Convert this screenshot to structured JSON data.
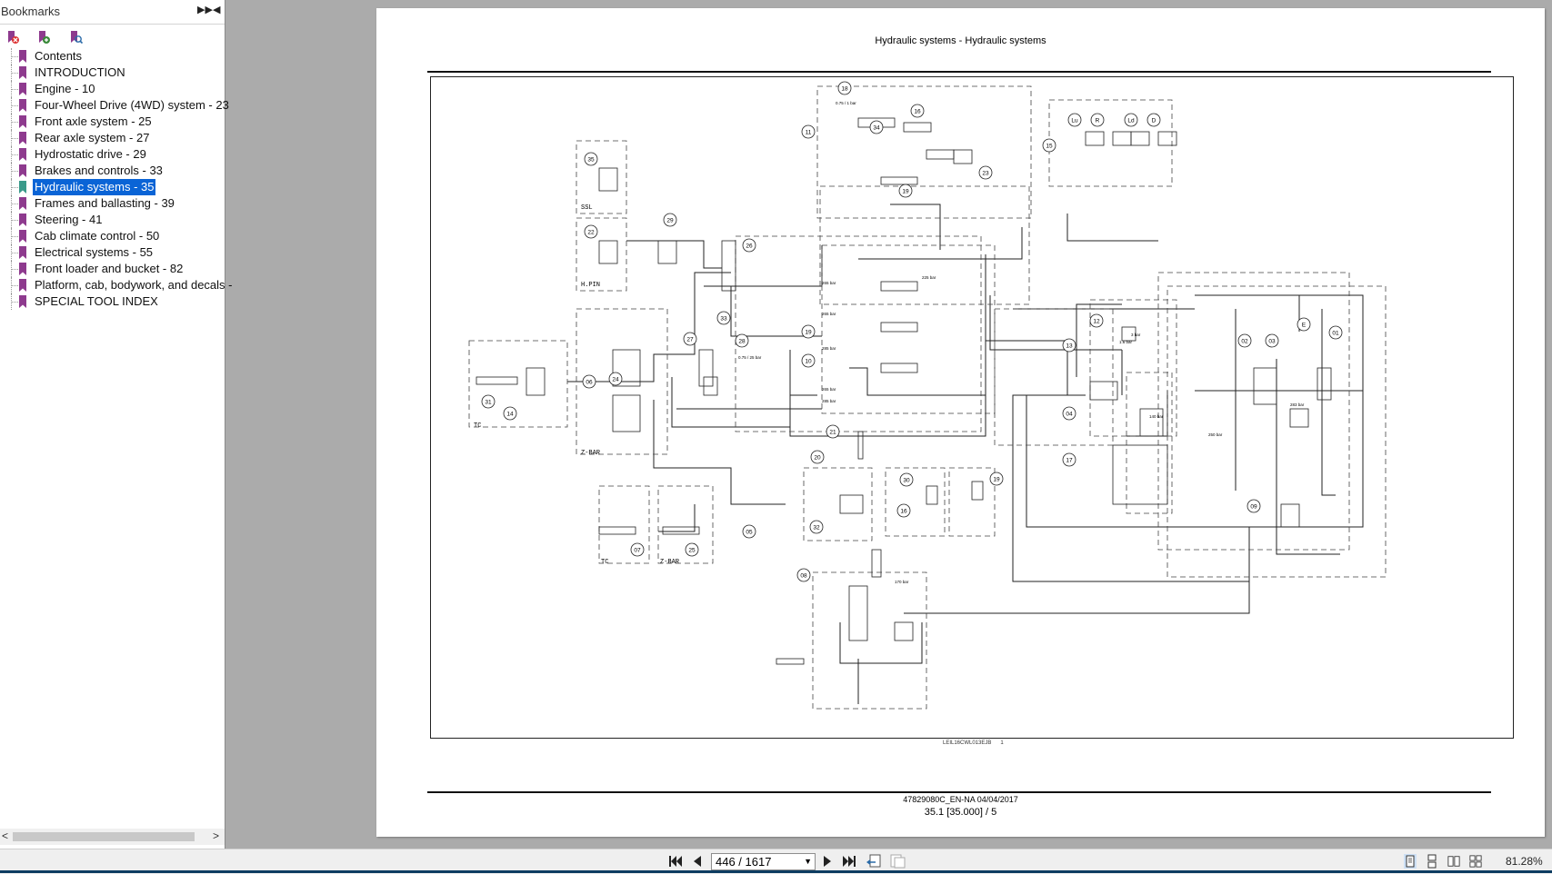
{
  "sidebar": {
    "title": "Bookmarks",
    "expand_icon": "double-chevron-right-icon",
    "collapse_icon": "triangle-left-icon",
    "tools": [
      "delete-bookmark-icon",
      "expand-bookmark-icon",
      "find-bookmark-icon"
    ],
    "items": [
      {
        "label": "Contents"
      },
      {
        "label": "INTRODUCTION"
      },
      {
        "label": "Engine - 10"
      },
      {
        "label": "Four-Wheel Drive (4WD) system - 23"
      },
      {
        "label": "Front axle system - 25"
      },
      {
        "label": "Rear axle system - 27"
      },
      {
        "label": "Hydrostatic drive - 29"
      },
      {
        "label": "Brakes and controls - 33"
      },
      {
        "label": "Hydraulic systems - 35"
      },
      {
        "label": "Frames and ballasting - 39"
      },
      {
        "label": "Steering - 41"
      },
      {
        "label": "Cab climate control - 50"
      },
      {
        "label": "Electrical systems - 55"
      },
      {
        "label": "Front loader and bucket - 82"
      },
      {
        "label": "Platform, cab, bodywork, and decals -"
      },
      {
        "label": "SPECIAL TOOL INDEX"
      }
    ],
    "selected_index": 8,
    "scroll_left": "<",
    "scroll_right": ">"
  },
  "document": {
    "title": "Hydraulic systems - Hydraulic systems",
    "figure_code": "LEIL16CWL013EJB",
    "figure_number": "1",
    "doc_code": "47829080C_EN-NA 04/04/2017",
    "page_ref": "35.1 [35.000] / 5",
    "callouts": [
      "18",
      "16",
      "11",
      "34",
      "23",
      "19",
      "15",
      "Lu",
      "R",
      "Ld",
      "D",
      "35",
      "22",
      "29",
      "26",
      "33",
      "19",
      "10",
      "21",
      "27",
      "28",
      "06",
      "24",
      "31",
      "14",
      "13",
      "12",
      "04",
      "02",
      "03",
      "E",
      "01",
      "17",
      "20",
      "30",
      "19",
      "16",
      "32",
      "07",
      "25",
      "05",
      "09",
      "08"
    ],
    "panel_labels": [
      "SSL",
      "H.PIN",
      "TC",
      "Z-BAR",
      "TC",
      "Z-BAR"
    ],
    "pressure_labels": [
      "265 bar",
      "265 bar",
      "285 bar",
      "265 bar",
      "285 bar",
      "225 bar",
      "170 bar",
      "0.75 / 1 bar",
      "0.75 / 25 bar",
      "3 bar",
      "1.6 bar",
      "140 bar",
      "250 bar",
      "283 bar"
    ]
  },
  "toolbar": {
    "first_icon": "first-page-icon",
    "prev_icon": "previous-page-icon",
    "page_value": "446 / 1617",
    "next_icon": "next-page-icon",
    "last_icon": "last-page-icon",
    "zoom": "81.28%"
  }
}
